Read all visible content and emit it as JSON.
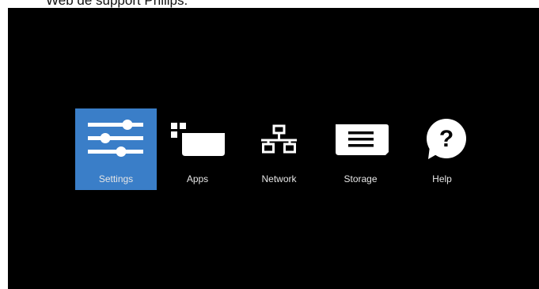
{
  "header": {
    "caption": "Web de support Philips."
  },
  "menu": {
    "items": [
      {
        "label": "Settings",
        "icon": "settings-sliders-icon",
        "selected": true
      },
      {
        "label": "Apps",
        "icon": "apps-icon",
        "selected": false
      },
      {
        "label": "Network",
        "icon": "network-icon",
        "selected": false
      },
      {
        "label": "Storage",
        "icon": "storage-icon",
        "selected": false
      },
      {
        "label": "Help",
        "icon": "help-icon",
        "selected": false
      }
    ]
  },
  "colors": {
    "background": "#000000",
    "selected_tile": "#3a7ec8",
    "icon": "#ffffff",
    "label": "#e6e6e6"
  }
}
